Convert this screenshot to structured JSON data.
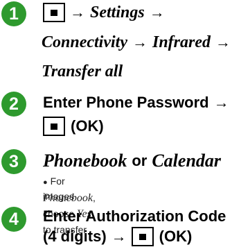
{
  "accent": "#2e9a2e",
  "icons": {
    "key": "menu-key-icon",
    "arrow": "right-arrow-icon"
  },
  "steps": [
    {
      "number": "1",
      "settings": "Settings",
      "connectivity": "Connectivity",
      "infrared": "Infrared",
      "transfer_all": "Transfer all"
    },
    {
      "number": "2",
      "enter_password": "Enter Phone Password",
      "ok": "(OK)"
    },
    {
      "number": "3",
      "phonebook": "Phonebook",
      "or": "or",
      "calendar": "Calendar",
      "note_prefix": "For",
      "note_phonebook": "Phonebook",
      "note_choose": ", choose",
      "note_yes": "Yes",
      "note_rest": "to transfer",
      "note_line2": "images"
    },
    {
      "number": "4",
      "line1": "Enter Authorization Code",
      "line2_prefix": "(4 digits)",
      "ok": "(OK)"
    }
  ]
}
